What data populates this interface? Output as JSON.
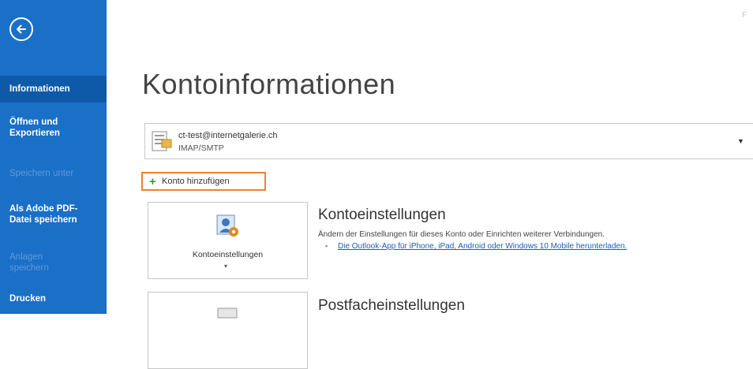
{
  "sidebar": {
    "back_icon": "back-arrow-icon",
    "items": [
      {
        "label_1": "Informationen",
        "label_2": ""
      },
      {
        "label_1": "Öffnen und",
        "label_2": "Exportieren"
      },
      {
        "label_1": "Speichern unter",
        "label_2": ""
      },
      {
        "label_1": "Als Adobe PDF-",
        "label_2": "Datei speichern"
      },
      {
        "label_1": "Anlagen",
        "label_2": "speichern"
      },
      {
        "label_1": "Drucken",
        "label_2": ""
      }
    ],
    "colors": {
      "background": "#1a6fc7",
      "active": "#0f5aa8",
      "disabled_text": "#5d9bdc"
    }
  },
  "header": {
    "title": "Kontoinformationen",
    "corner_text": "F"
  },
  "account": {
    "email": "ct-test@internetgalerie.ch",
    "type": "IMAP/SMTP",
    "icon": "account-folder-icon",
    "dropdown_icon": "dropdown-arrow-icon"
  },
  "add_account": {
    "label": "Konto hinzufügen",
    "icon": "plus-icon",
    "highlight_color": "#f08030"
  },
  "sections": {
    "account_settings": {
      "card_label": "Kontoeinstellungen",
      "title": "Kontoeinstellungen",
      "description": "Ändern der Einstellungen für dieses Konto oder Einrichten weiterer Verbindungen.",
      "link": "Die Outlook-App für iPhone, iPad, Android oder Windows 10 Mobile herunterladen.",
      "icon": "account-settings-icon"
    },
    "mailbox_settings": {
      "title": "Postfacheinstellungen",
      "icon": "mailbox-settings-icon"
    }
  }
}
